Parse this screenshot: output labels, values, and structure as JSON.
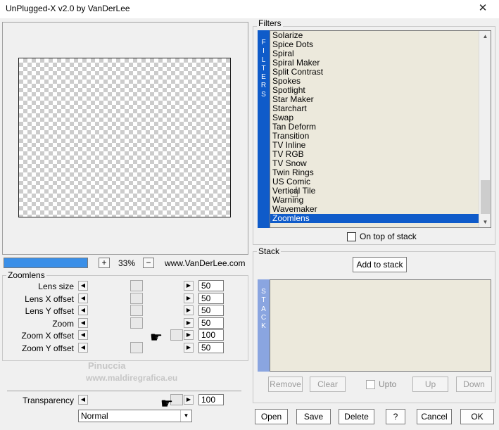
{
  "window": {
    "title": "UnPlugged-X v2.0 by VanDerLee",
    "close_glyph": "✕"
  },
  "zoom": {
    "plus_label": "+",
    "minus_label": "−",
    "value": "33%",
    "website": "www.VanDerLee.com"
  },
  "zoomlens": {
    "group_label": "Zoomlens",
    "sliders": [
      {
        "label": "Lens size",
        "value": "50",
        "level": 0.5
      },
      {
        "label": "Lens X offset",
        "value": "50",
        "level": 0.5
      },
      {
        "label": "Lens Y offset",
        "value": "50",
        "level": 0.5
      },
      {
        "label": "Zoom",
        "value": "50",
        "level": 0.5
      },
      {
        "label": "Zoom X offset",
        "value": "100",
        "level": 1.0
      },
      {
        "label": "Zoom Y offset",
        "value": "50",
        "level": 0.5
      }
    ]
  },
  "transparency": {
    "label": "Transparency",
    "value": "100",
    "level": 1.0
  },
  "blend": {
    "selected": "Normal"
  },
  "filters": {
    "group_label": "Filters",
    "strip_letters": [
      "F",
      "I",
      "L",
      "T",
      "E",
      "R",
      "S"
    ],
    "items": [
      "Solarize",
      "Spice Dots",
      "Spiral",
      "Spiral Maker",
      "Split Contrast",
      "Spokes",
      "Spotlight",
      "Star Maker",
      "Starchart",
      "Swap",
      "Tan Deform",
      "Transition",
      "TV Inline",
      "TV RGB",
      "TV Snow",
      "Twin Rings",
      "US Comic",
      "Vertical Tile",
      "Warning",
      "Wavemaker",
      "Zoomlens"
    ],
    "selected": "Zoomlens",
    "on_top_label": "On top of stack"
  },
  "stack": {
    "group_label": "Stack",
    "add_label": "Add to stack",
    "strip_letters": [
      "S",
      "T",
      "A",
      "C",
      "K"
    ],
    "remove_label": "Remove",
    "clear_label": "Clear",
    "upto_label": "Upto",
    "up_label": "Up",
    "down_label": "Down"
  },
  "footer": {
    "open": "Open",
    "save": "Save",
    "delete": "Delete",
    "help": "?",
    "cancel": "Cancel",
    "ok": "OK"
  },
  "watermark": {
    "name": "Pinuccia",
    "site": "www.maldiregrafica.eu"
  },
  "colors": {
    "accent": "#0f5bc9",
    "zoom_bar": "#3a8fe8",
    "list_bg": "#ece9dc",
    "stack_strip": "#8aa5e0"
  }
}
